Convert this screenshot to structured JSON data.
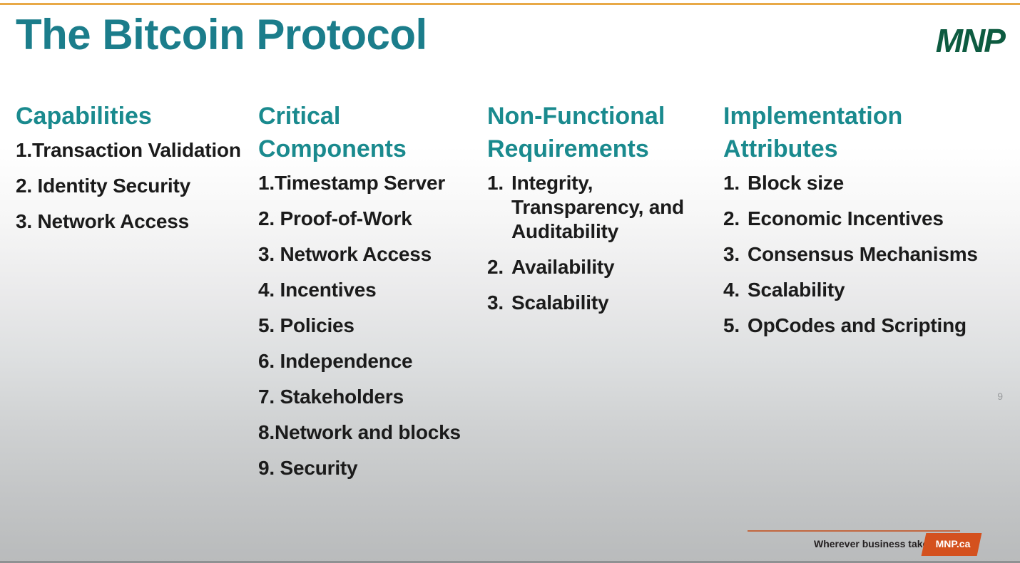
{
  "slide": {
    "title": "The Bitcoin Protocol",
    "logo": "MNP",
    "page_number": "9",
    "accent_teal": "#1a8a8e",
    "title_teal": "#1b7d8b",
    "logo_green": "#0d5b40",
    "rule_gold": "#e8a947",
    "footer_orange": "#d4511e"
  },
  "columns": [
    {
      "heading": "Capabilities",
      "items": [
        {
          "marker": "1.",
          "text": "Transaction Validation"
        },
        {
          "marker": "2. ",
          "text": "Identity Security"
        },
        {
          "marker": "3. ",
          "text": "Network Access"
        }
      ]
    },
    {
      "heading": "Critical Components",
      "items": [
        {
          "marker": "1.",
          "text": "Timestamp Server"
        },
        {
          "marker": "2. ",
          "text": "Proof-of-Work"
        },
        {
          "marker": "3. ",
          "text": "Network Access"
        },
        {
          "marker": "4. ",
          "text": "Incentives"
        },
        {
          "marker": "5. ",
          "text": "Policies"
        },
        {
          "marker": "6. ",
          "text": "Independence"
        },
        {
          "marker": "7. ",
          "text": "Stakeholders"
        },
        {
          "marker": "8.",
          "text": "Network and blocks"
        },
        {
          "marker": "9. ",
          "text": "Security"
        }
      ]
    },
    {
      "heading": "Non-Functional Requirements",
      "items": [
        {
          "marker": "1.",
          "text": "Integrity, Transparency, and Auditability"
        },
        {
          "marker": "2.",
          "text": "Availability"
        },
        {
          "marker": "3.",
          "text": "Scalability"
        }
      ]
    },
    {
      "heading": "Implementation Attributes",
      "items": [
        {
          "marker": "1.",
          "text": "Block size"
        },
        {
          "marker": "2.",
          "text": "Economic Incentives"
        },
        {
          "marker": "3.",
          "text": "Consensus Mechanisms"
        },
        {
          "marker": "4.",
          "text": "Scalability"
        },
        {
          "marker": "5.",
          "text": "OpCodes and Scripting"
        }
      ]
    }
  ],
  "footer": {
    "tagline": "Wherever business takes you",
    "badge_label": "MNP.ca"
  }
}
